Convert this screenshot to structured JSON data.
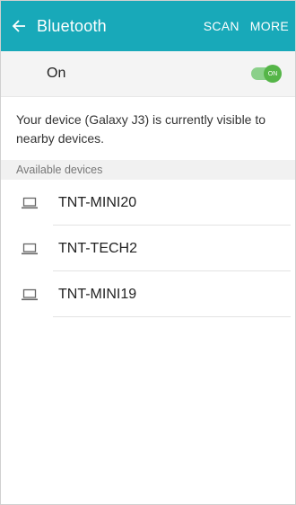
{
  "appbar": {
    "title": "Bluetooth",
    "scan_label": "SCAN",
    "more_label": "MORE",
    "color": "#18a9b9"
  },
  "bluetooth_toggle": {
    "label": "On",
    "switch_text": "ON",
    "state": "on",
    "color": "#55b548"
  },
  "visibility_text": "Your device (Galaxy J3) is currently visible to nearby devices.",
  "available": {
    "header": "Available devices",
    "devices": [
      {
        "name": "TNT-MINI20",
        "icon": "laptop-icon"
      },
      {
        "name": "TNT-TECH2",
        "icon": "laptop-icon"
      },
      {
        "name": "TNT-MINI19",
        "icon": "laptop-icon"
      }
    ]
  }
}
